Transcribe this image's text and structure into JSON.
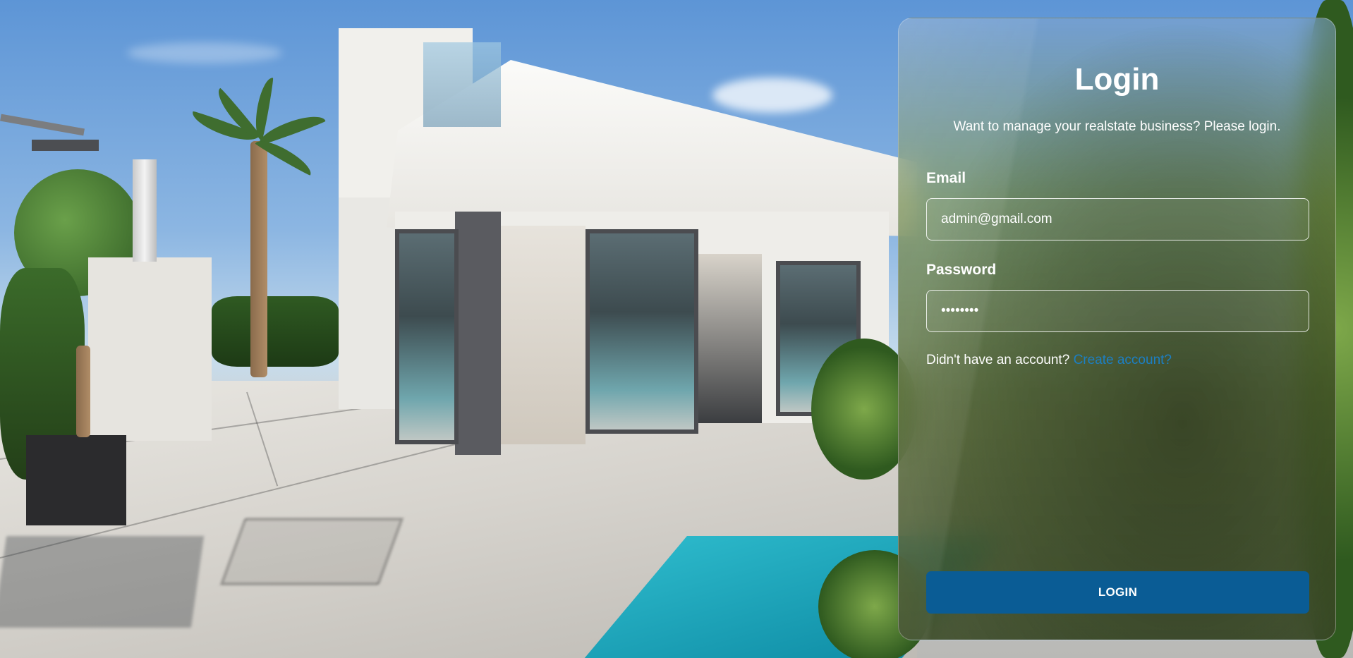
{
  "background": {
    "description_icon": "house-photo"
  },
  "login": {
    "title": "Login",
    "subtitle": "Want to manage your realstate business? Please login.",
    "email": {
      "label": "Email",
      "value": "admin@gmail.com"
    },
    "password": {
      "label": "Password",
      "value": "••••••••"
    },
    "signup_prompt": "Didn't have an account?",
    "signup_link": "Create account?",
    "button_label": "LOGIN"
  },
  "colors": {
    "button": "#0a5c95",
    "link": "#1c7fc4",
    "text": "#ffffff"
  }
}
